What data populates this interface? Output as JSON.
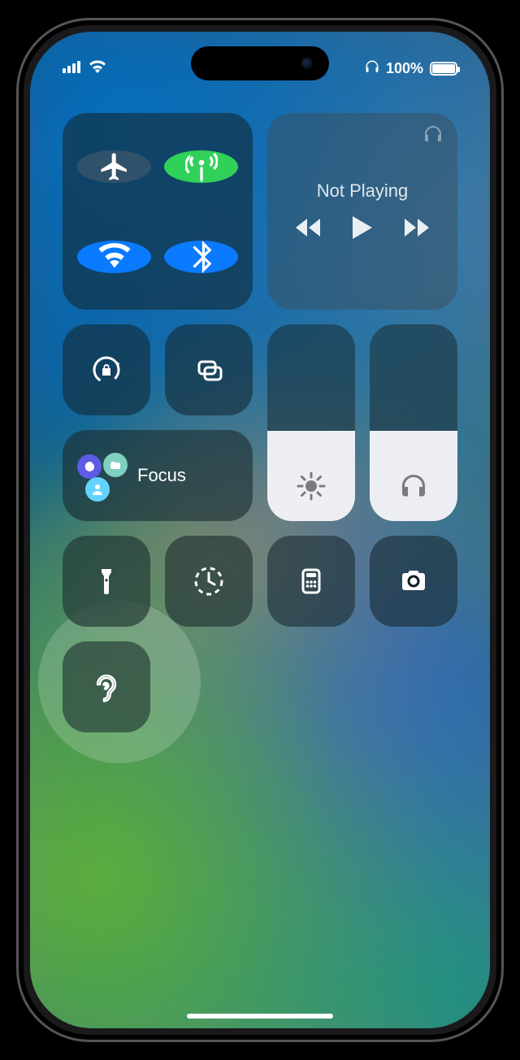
{
  "status": {
    "battery_percent": "100%",
    "battery_fill_pct": 100
  },
  "media": {
    "title": "Not Playing"
  },
  "focus": {
    "label": "Focus"
  },
  "sliders": {
    "brightness_pct": 46,
    "volume_pct": 46
  },
  "icons": {
    "airplane": "airplane-icon",
    "cellular": "cellular-antenna-icon",
    "wifi": "wifi-icon",
    "bluetooth": "bluetooth-icon",
    "headphones": "headphones-icon",
    "rewind": "rewind-icon",
    "play": "play-icon",
    "forward": "forward-icon",
    "orientation_lock": "orientation-lock-icon",
    "screen_mirror": "screen-mirroring-icon",
    "dnd": "do-not-disturb-icon",
    "sleep": "sleep-icon",
    "personal": "personal-icon",
    "brightness": "brightness-icon",
    "volume": "headphones-icon",
    "flashlight": "flashlight-icon",
    "timer": "timer-icon",
    "calculator": "calculator-icon",
    "camera": "camera-icon",
    "hearing": "hearing-icon"
  },
  "colors": {
    "toggle_blue": "#0a7aff",
    "toggle_green": "#30d158",
    "tile_bg": "rgba(20,35,40,0.55)"
  }
}
